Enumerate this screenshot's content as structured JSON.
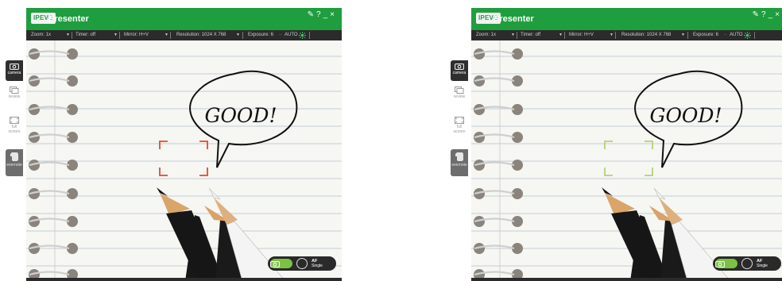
{
  "app": {
    "logo_text": "IPEVO",
    "title": "Presenter"
  },
  "title_controls": {
    "tool": "✎",
    "help": "?",
    "minimize": "_",
    "close": "×"
  },
  "toolbar": {
    "zoom": "Zoom: 1x",
    "timer": "Timer: off",
    "mirror": "Mirror: H+V",
    "resolution": "Resolution: 1024 X 768",
    "exposure": "Exposure: 6",
    "auto": "AUTO"
  },
  "sidebar": {
    "camera": "camera",
    "review": "review",
    "full_screen_1": "full",
    "full_screen_2": "screen",
    "evernote": "evernote"
  },
  "view": {
    "speech_text": "GOOD!"
  },
  "capture": {
    "af_title": "AF",
    "af_mode": "Single"
  },
  "colors": {
    "brand_green": "#1f9e3f",
    "focus_left": "#e8472a",
    "focus_right": "#b5d07a",
    "capture_green": "#7bc143"
  },
  "icons": [
    "camera-icon",
    "review-icon",
    "full-screen-icon",
    "evernote-icon",
    "wrench-icon",
    "help-icon",
    "minimize-icon",
    "close-icon",
    "af-icon"
  ]
}
